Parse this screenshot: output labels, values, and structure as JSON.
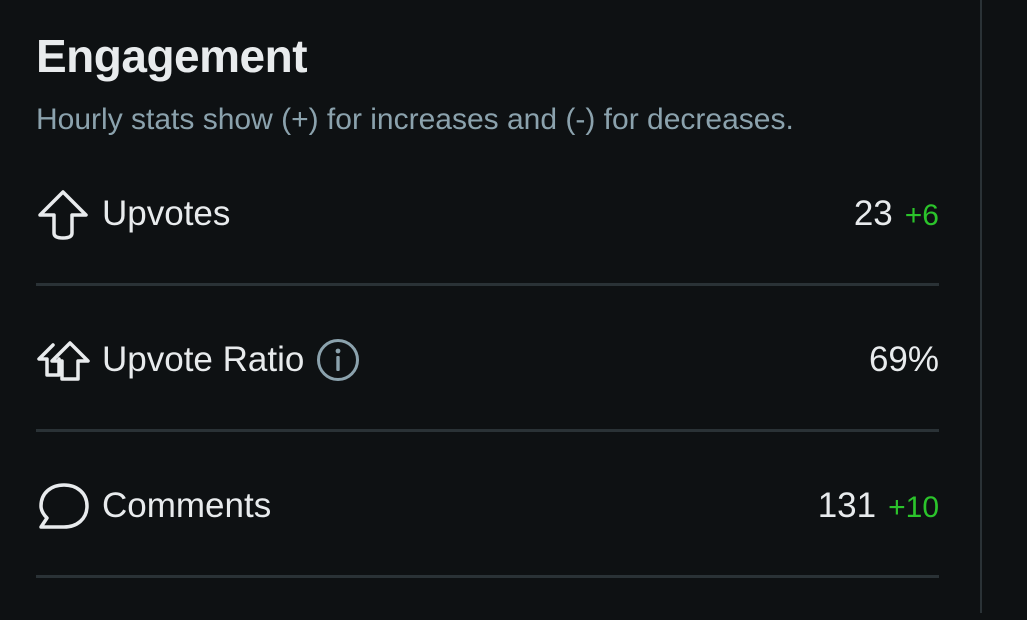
{
  "engagement": {
    "title": "Engagement",
    "subtitle": "Hourly stats show (+) for increases and (-) for decreases.",
    "colors": {
      "background": "#0e1113",
      "text": "#e8ebed",
      "muted": "#8ba2ad",
      "positive": "#2bc42b",
      "divider": "#2a3236"
    },
    "stats": [
      {
        "icon": "upvote-arrow-icon",
        "label": "Upvotes",
        "value": "23",
        "delta": "+6"
      },
      {
        "icon": "upvote-ratio-icon",
        "label": "Upvote Ratio",
        "value": "69%",
        "delta": "",
        "info_icon": "info-icon"
      },
      {
        "icon": "comment-bubble-icon",
        "label": "Comments",
        "value": "131",
        "delta": "+10"
      }
    ]
  }
}
